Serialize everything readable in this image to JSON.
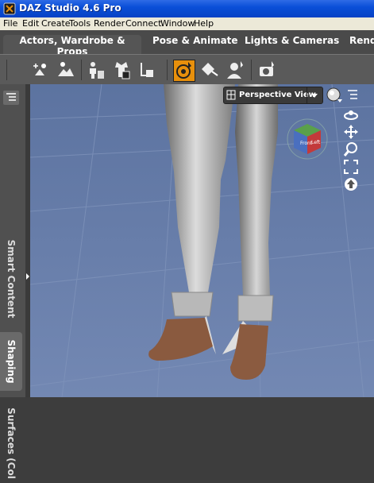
{
  "window": {
    "title": "DAZ Studio 4.6 Pro"
  },
  "menu": [
    "File",
    "Edit",
    "Create",
    "Tools",
    "Render",
    "Connect",
    "Window",
    "Help"
  ],
  "tabs": {
    "actors": "Actors, Wardrobe & Props",
    "pose": "Pose & Animate",
    "lights": "Lights & Cameras",
    "render": "Rend"
  },
  "left_panel": {
    "smart_content": "Smart Content",
    "shaping": "Shaping",
    "surfaces": "Surfaces (Col"
  },
  "viewport": {
    "view_name": "Perspective View",
    "cube_front": "Front",
    "cube_left": "Left"
  },
  "colors": {
    "titlebar": "#0a4fd8",
    "toolbar": "#5a5a5a",
    "viewport_bg": "#5d75a3",
    "active_tool": "#e8900c"
  }
}
